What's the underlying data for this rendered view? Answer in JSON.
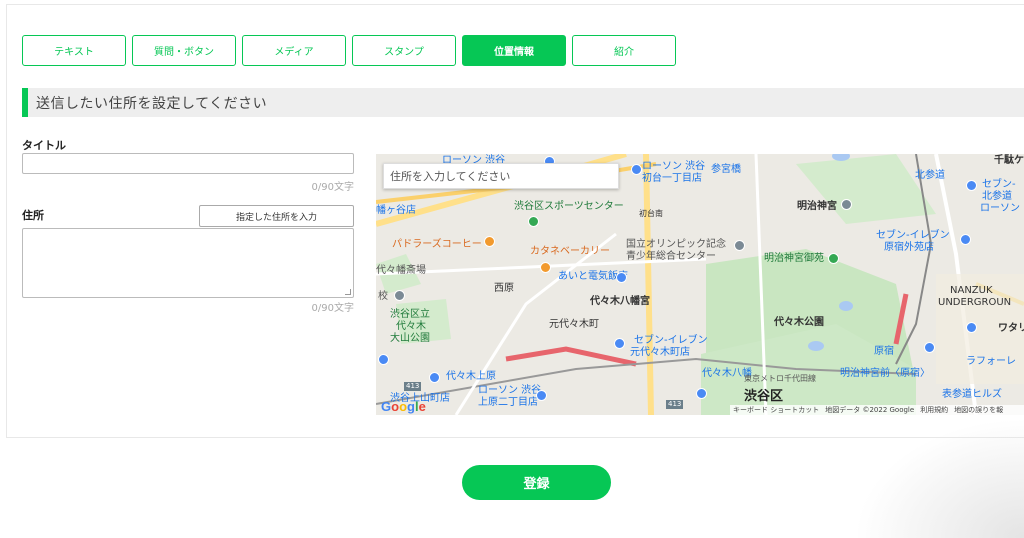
{
  "tabs": [
    {
      "label": "テキスト",
      "active": false
    },
    {
      "label": "質問・ボタン",
      "active": false
    },
    {
      "label": "メディア",
      "active": false
    },
    {
      "label": "スタンプ",
      "active": false
    },
    {
      "label": "位置情報",
      "active": true
    },
    {
      "label": "紹介",
      "active": false
    }
  ],
  "section": {
    "heading": "送信したい住所を設定してください"
  },
  "form": {
    "title_label": "タイトル",
    "title_value": "",
    "title_counter": "0/90文字",
    "address_label": "住所",
    "address_button": "指定した住所を入力",
    "address_value": "",
    "address_counter": "0/90文字"
  },
  "map": {
    "search_placeholder": "住所を入力してください",
    "labels": {
      "lawson_shibuya": "ローソン 渋谷",
      "lawson_hatsudai_1": "ローソン 渋谷",
      "lawson_hatsudai_2": "初台一丁目店",
      "sangubashi": "参宮橋",
      "meiji_jingu": "明治神宮",
      "sendagaya": "千駄ケ",
      "kitasando": "北参道",
      "seven_kitasando_1": "セブン-",
      "seven_kitasando_2": "北参道",
      "lawson_right": "ローソン",
      "hatagaya": "幡ヶ谷店",
      "sports_center": "渋谷区スポーツセンター",
      "hatsudaitn": "初台南",
      "olympic_1": "国立オリンピック記念",
      "olympic_2": "青少年総合センター",
      "meiji_gyoen": "明治神宮御苑",
      "seven_harajuku_1": "セブン-イレブン",
      "seven_harajuku_2": "原宿外苑店",
      "padlers": "パドラーズコーヒー",
      "katane": "カタネベーカリー",
      "aito": "あいと電気飯店",
      "yoyogi_hachiman": "代々木八幡宮",
      "nishihara": "西原",
      "motoyoyogi": "元代々木町",
      "nanzuk_1": "NANZUK",
      "nanzuk_2": "UNDERGROUN",
      "wata": "ワタリ",
      "yoyogi_park": "代々木公園",
      "park_school_1": "渋谷区立",
      "park_school_2": "代々木",
      "park_school_3": "大山公園",
      "seven_motoyoyogi_1": "セブン-イレブン",
      "seven_motoyoyogi_2": "元代々木町店",
      "laforet": "ラフォーレ",
      "harajuku": "原宿",
      "yoyogi_uehara": "代々木上原",
      "yoyogi_hachiman_st": "代々木八幡",
      "metro_line": "東京メトロ千代田線",
      "meiji_jingumae": "明治神宮前〈原宿〉",
      "lawson_uehara_1": "ローソン 渋谷",
      "lawson_uehara_2": "上原二丁目店",
      "shibuya_ku": "渋谷区",
      "omotesando_hills": "表参道ヒルズ",
      "shibuya_nishihara": "渋谷上山町店",
      "yoyogi_hatagaya": "代々幡斎場",
      "route_413a": "413",
      "route_413b": "413",
      "school": "校"
    },
    "footer": {
      "shortcuts": "キーボード ショートカット",
      "data": "地図データ ©2022 Google",
      "terms": "利用規約",
      "report": "地図の誤りを報"
    },
    "logo_letters": [
      "G",
      "o",
      "o",
      "g",
      "l",
      "e"
    ]
  },
  "submit_label": "登録",
  "colors": {
    "accent": "#06c755",
    "heading_bg": "#eeeeee"
  }
}
